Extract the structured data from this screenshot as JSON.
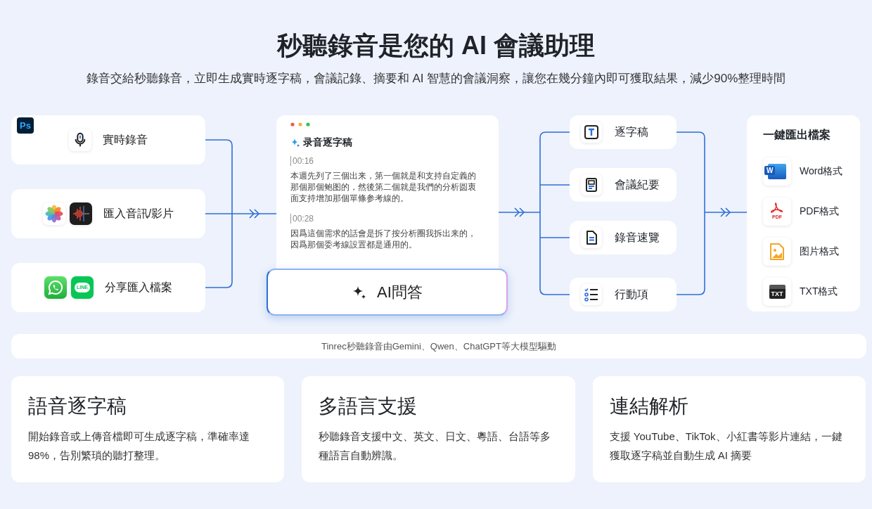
{
  "header": {
    "title": "秒聽錄音是您的 AI 會議助理",
    "subtitle": "錄音交給秒聽錄音，立即生成實時逐字稿，會議記錄、摘要和 AI 智慧的會議洞察，讓您在幾分鐘內即可獲取結果，減少90%整理時間"
  },
  "badge": "Ps",
  "sources": [
    {
      "label": "實時錄音",
      "icons": [
        {
          "kind": "mic"
        }
      ]
    },
    {
      "label": "匯入音訊/影片",
      "icons": [
        {
          "kind": "photos"
        },
        {
          "kind": "voice-memo"
        }
      ]
    },
    {
      "label": "分享匯入檔案",
      "icons": [
        {
          "kind": "whatsapp"
        },
        {
          "kind": "line",
          "text": "LINE"
        }
      ]
    }
  ],
  "transcript": {
    "title": "录音逐字稿",
    "entries": [
      {
        "time": "00:16",
        "text": "本週先列了三個出来，第一個就是和支持自定義的那個那個鲍图的，然後第二個就是我們的分析圆衷面支持增加那個單條参考線的。"
      },
      {
        "time": "00:28",
        "text": "因爲這個需求的話會是拆了按分析圈我拆出来的，因爲那個委考線設置都是通用的。"
      }
    ]
  },
  "ai_button": "AI問答",
  "outputs": [
    {
      "label": "逐字稿",
      "kind": "t"
    },
    {
      "label": "會議紀要",
      "kind": "summary"
    },
    {
      "label": "錄音速覽",
      "kind": "doc"
    },
    {
      "label": "行動項",
      "kind": "checklist"
    }
  ],
  "export": {
    "title": "一鍵匯出檔案",
    "formats": [
      {
        "label": "Word格式",
        "kind": "word",
        "icon_text": "W"
      },
      {
        "label": "PDF格式",
        "kind": "pdf",
        "icon_text": "PDF"
      },
      {
        "label": "图片格式",
        "kind": "image"
      },
      {
        "label": "TXT格式",
        "kind": "txt",
        "icon_text": "TXT"
      }
    ]
  },
  "powered_by": "Tinrec秒聽錄音由Gemini、Qwen、ChatGPT等大模型驅動",
  "features": [
    {
      "title": "語音逐字稿",
      "text": "開始錄音或上傳音檔即可生成逐字稿，準確率達98%，告別繁瑣的聽打整理。"
    },
    {
      "title": "多語言支援",
      "text": "秒聽錄音支援中文、英文、日文、粵語、台語等多種語言自動辨識。"
    },
    {
      "title": "連結解析",
      "text": "支援 YouTube、TikTok、小紅書等影片連結，一鍵獲取逐字稿並自動生成 AI 摘要"
    }
  ]
}
